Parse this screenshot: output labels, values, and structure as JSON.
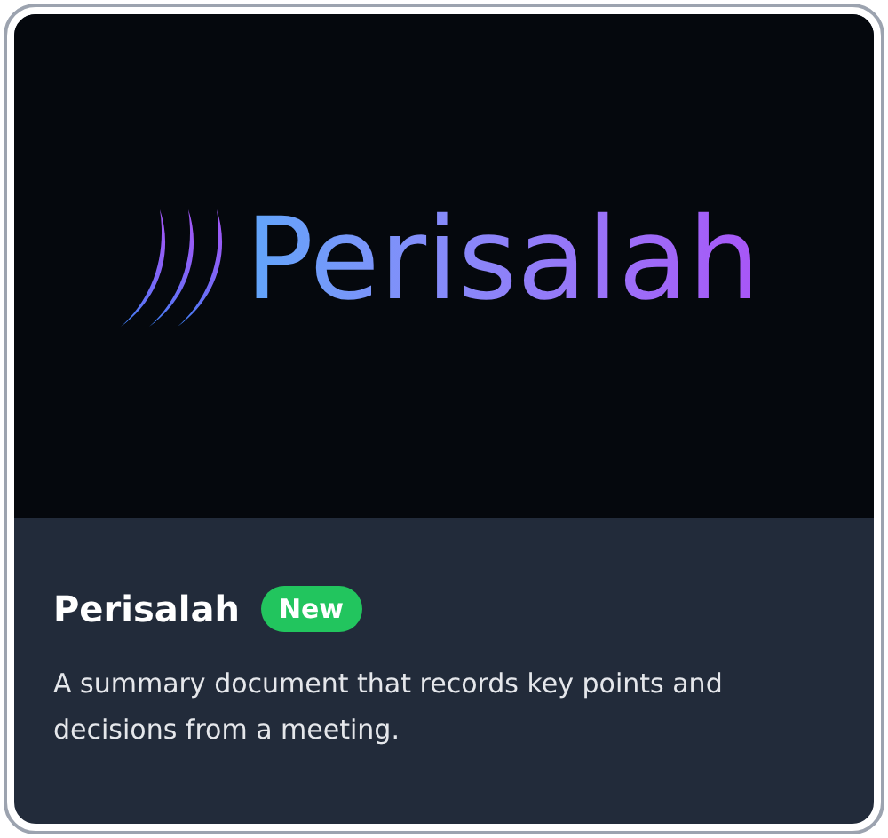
{
  "logo": {
    "wordmark": "Perisalah"
  },
  "card": {
    "title": "Perisalah",
    "badge": "New",
    "description": "A summary document that records key points and decisions from a meeting."
  }
}
